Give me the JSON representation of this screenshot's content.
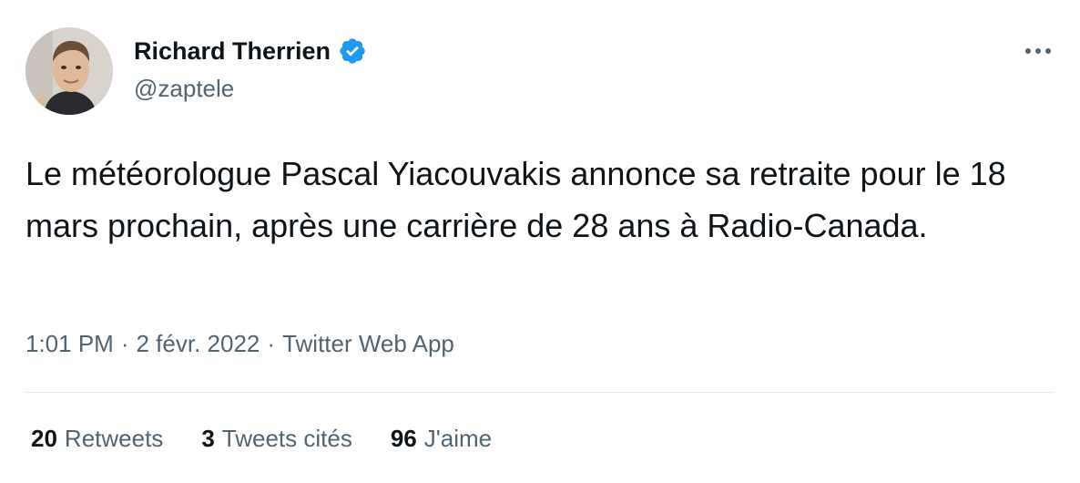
{
  "author": {
    "display_name": "Richard Therrien",
    "handle": "@zaptele",
    "verified": true,
    "avatar_icon": "profile-photo"
  },
  "tweet": {
    "text": "Le météorologue Pascal Yiacouvakis annonce sa retraite pour le 18 mars prochain, après une carrière de 28 ans à Radio-Canada.",
    "time": "1:01 PM",
    "separator": "·",
    "date": "2 févr. 2022",
    "source": "Twitter Web App"
  },
  "stats": {
    "retweets_count": "20",
    "retweets_label": "Retweets",
    "quotes_count": "3",
    "quotes_label": "Tweets cités",
    "likes_count": "96",
    "likes_label": "J'aime"
  },
  "icons": {
    "verified": "verified-badge-icon",
    "more": "more-options-icon"
  },
  "colors": {
    "text_primary": "#0f1419",
    "text_secondary": "#536471",
    "verified_blue": "#1d9bf0",
    "divider": "#e6ecf0"
  }
}
